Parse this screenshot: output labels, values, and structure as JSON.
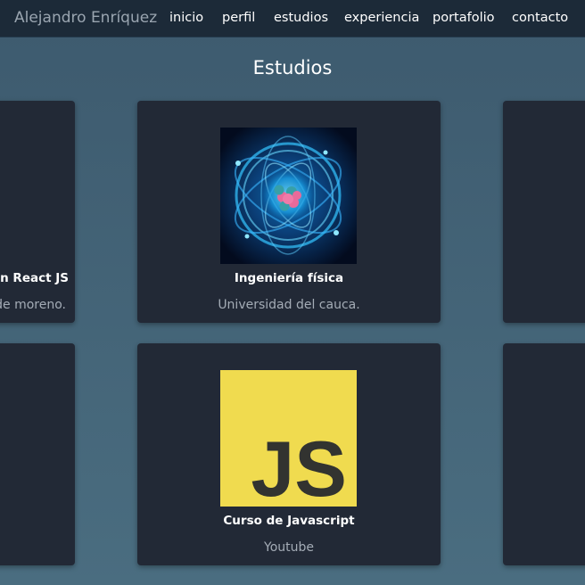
{
  "navbar": {
    "brand": "Alejandro Enríquez",
    "links": [
      "inicio",
      "perfil",
      "estudios",
      "experiencia",
      "portafolio",
      "contacto"
    ]
  },
  "section": {
    "title": "Estudios"
  },
  "cards": {
    "left_partial": {
      "title": "con React JS",
      "subtitle": "de moreno."
    },
    "physics": {
      "title": "Ingeniería física",
      "subtitle": "Universidad del cauca.",
      "image_icon": "atom-image"
    },
    "javascript": {
      "title": "Curso de Javascript",
      "subtitle": "Youtube",
      "image_icon": "javascript-logo",
      "logo_text": "JS",
      "logo_color": "#f0db4f"
    }
  },
  "colors": {
    "navbar_bg": "#1c2a38",
    "card_bg": "#222936",
    "page_bg": "#45667a"
  }
}
